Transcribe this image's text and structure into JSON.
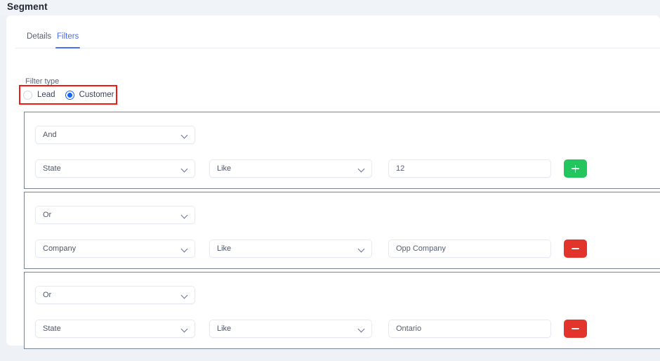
{
  "page": {
    "title": "Segment",
    "background_color": "#eef1f6",
    "card_color": "#ffffff",
    "header_strip_color": "#f0f3f8"
  },
  "tabs": [
    {
      "label": "Details",
      "active": false
    },
    {
      "label": "Filters",
      "active": true
    }
  ],
  "accent_color": "#4a6cf7",
  "filter_type": {
    "label": "Filter type",
    "highlight_color": "#f41a12",
    "options": [
      {
        "label": "Lead",
        "selected": false
      },
      {
        "label": "Customer",
        "selected": true
      }
    ]
  },
  "groups": [
    {
      "conjunction": "And",
      "field": "State",
      "operator": "Like",
      "value": "12",
      "action": {
        "name": "add",
        "glyph": "+",
        "color": "#22c55e"
      }
    },
    {
      "conjunction": "Or",
      "field": "Company",
      "operator": "Like",
      "value": "Opp Company",
      "action": {
        "name": "remove",
        "glyph": "−",
        "color": "#e2342a"
      }
    },
    {
      "conjunction": "Or",
      "field": "State",
      "operator": "Like",
      "value": "Ontario",
      "action": {
        "name": "remove",
        "glyph": "−",
        "color": "#e2342a"
      }
    }
  ],
  "icons": {
    "chevron_down": "chevron-down-icon"
  }
}
